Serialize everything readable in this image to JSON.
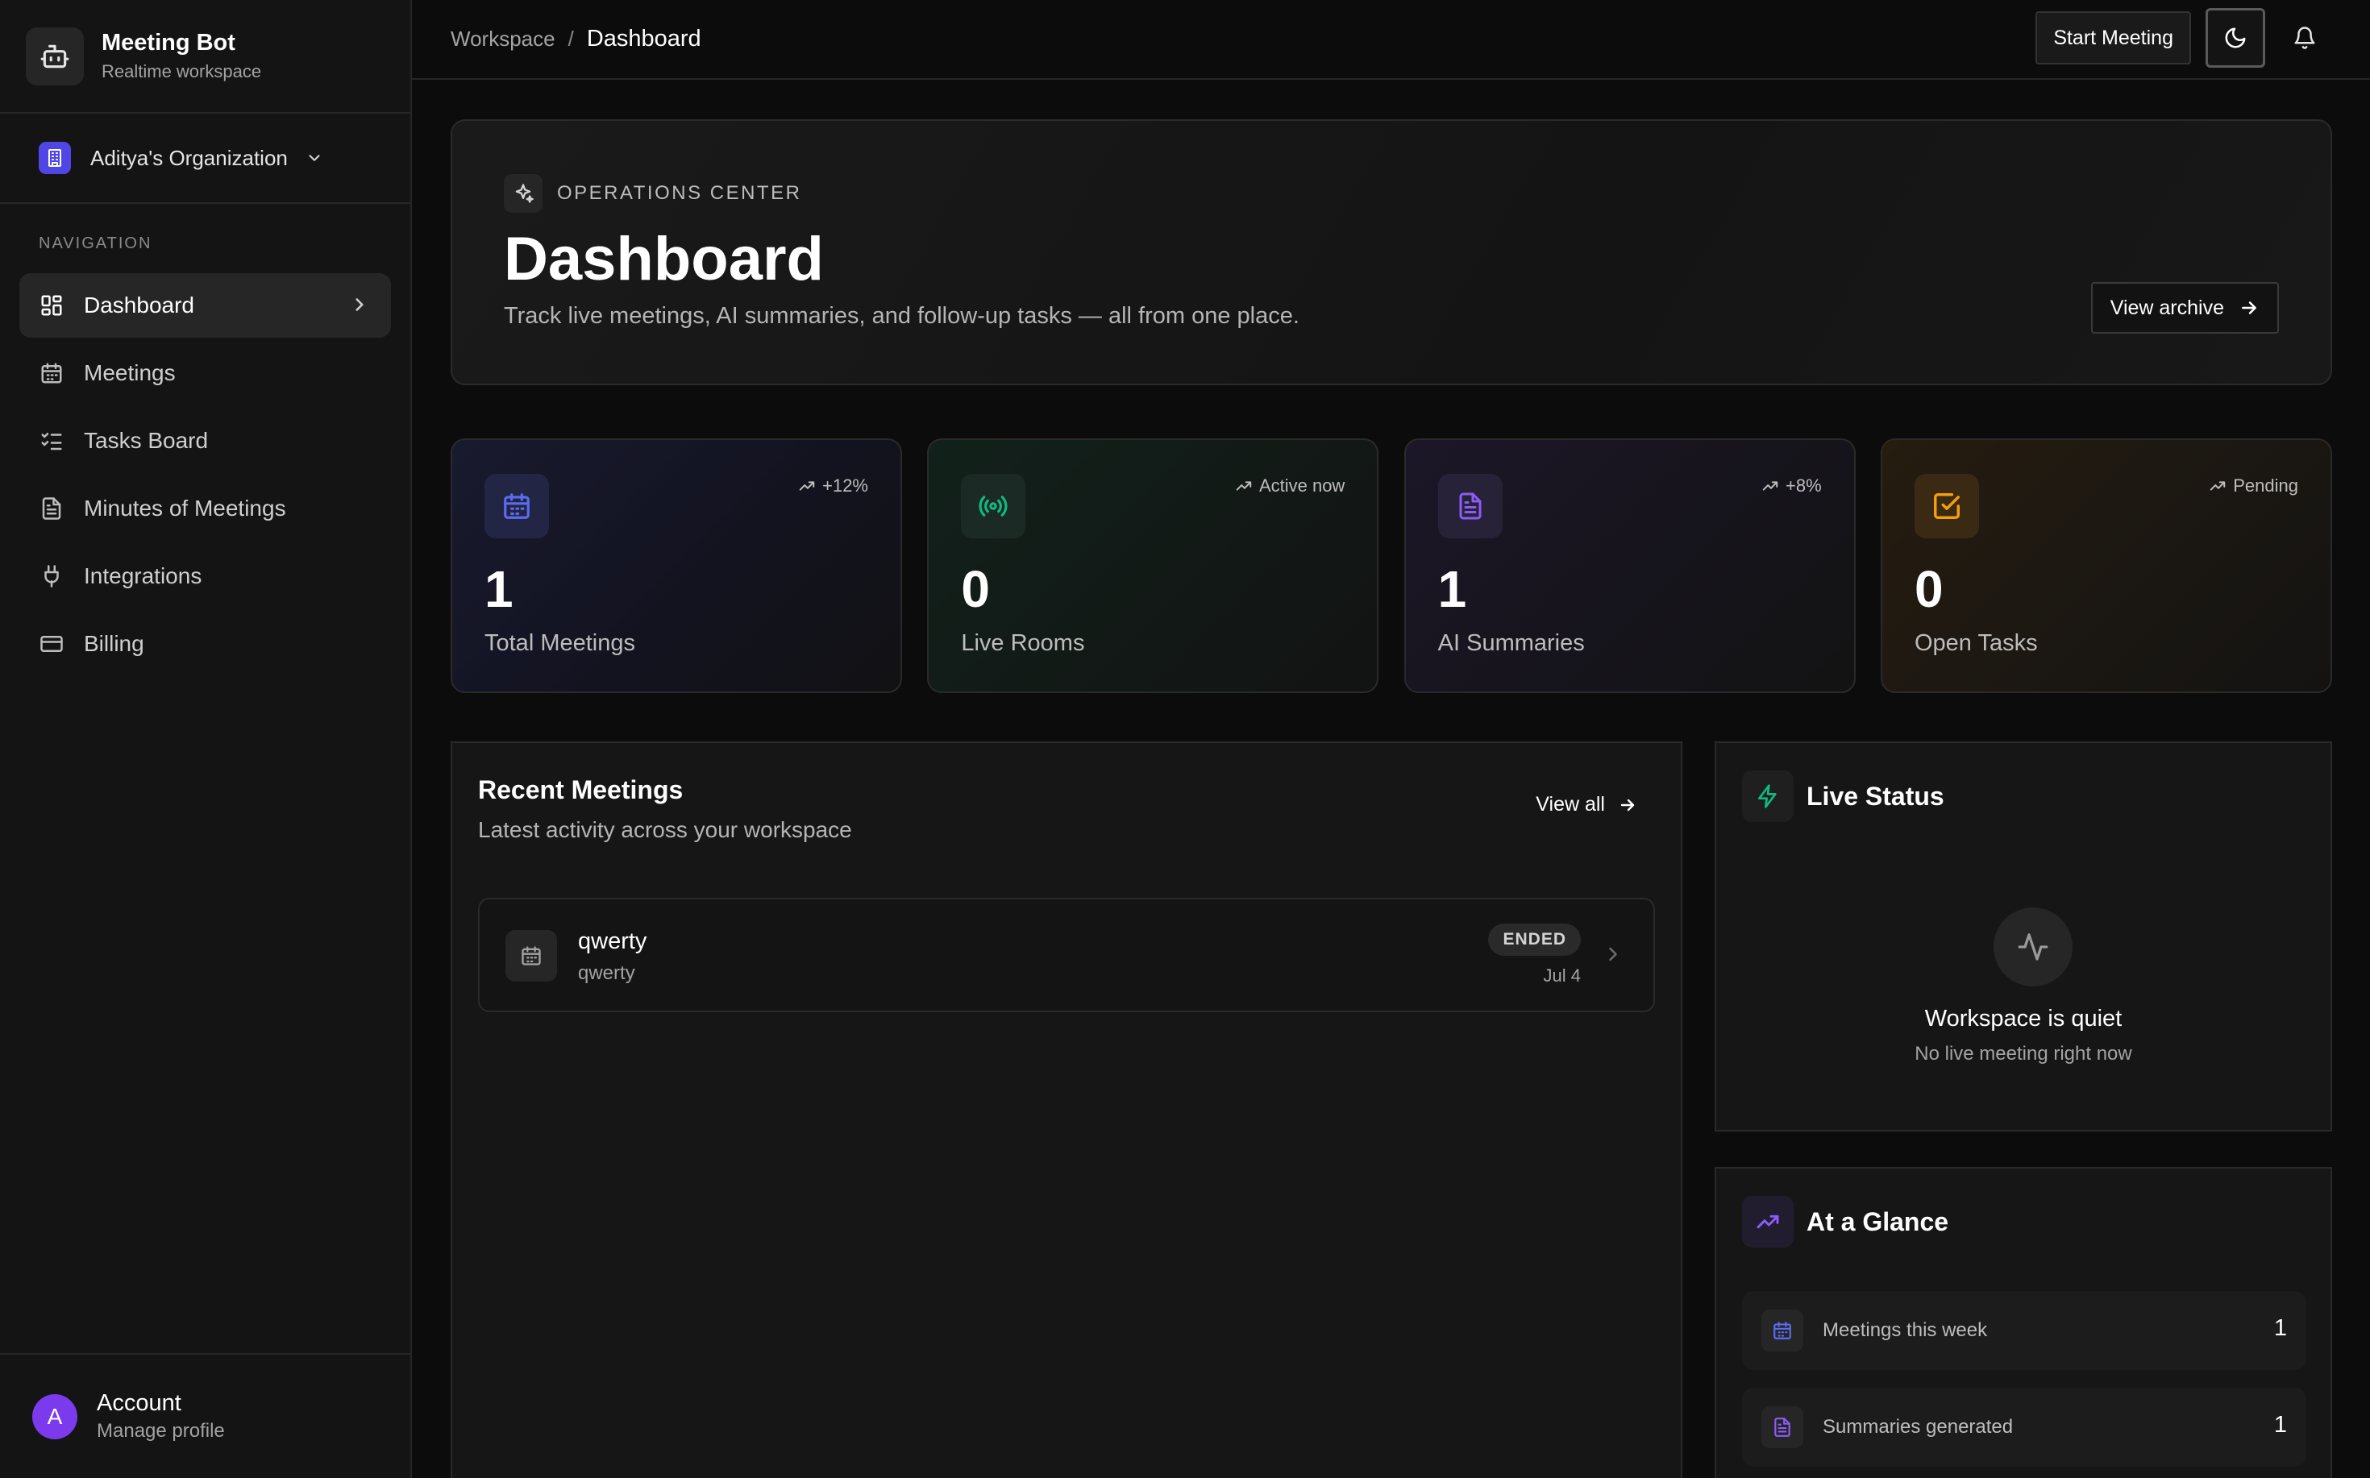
{
  "brand": {
    "title": "Meeting Bot",
    "subtitle": "Realtime workspace",
    "icon": "bot-icon"
  },
  "org": {
    "name": "Aditya's Organization",
    "icon": "building-icon",
    "accent": "#4f46e5"
  },
  "nav": {
    "heading": "NAVIGATION",
    "items": [
      {
        "label": "Dashboard",
        "icon": "layout-grid-icon",
        "active": true
      },
      {
        "label": "Meetings",
        "icon": "calendar-icon"
      },
      {
        "label": "Tasks Board",
        "icon": "list-checks-icon"
      },
      {
        "label": "Minutes of Meetings",
        "icon": "file-text-icon"
      },
      {
        "label": "Integrations",
        "icon": "plug-icon"
      },
      {
        "label": "Billing",
        "icon": "credit-card-icon"
      }
    ]
  },
  "account": {
    "initial": "A",
    "title": "Account",
    "subtitle": "Manage profile",
    "color": "#7c3aed"
  },
  "topbar": {
    "crumbs": [
      "Workspace",
      "/",
      "Dashboard"
    ],
    "start_label": "Start Meeting"
  },
  "hero": {
    "kicker": "OPERATIONS CENTER",
    "title": "Dashboard",
    "description": "Track live meetings, AI summaries, and follow-up tasks — all from one place.",
    "archive_label": "View archive"
  },
  "stats": [
    {
      "value": "1",
      "label": "Total Meetings",
      "trend": "+12%",
      "icon": "calendar-icon",
      "color": "#5b6cf0"
    },
    {
      "value": "0",
      "label": "Live Rooms",
      "trend": "Active now",
      "icon": "radio-icon",
      "color": "#10b981"
    },
    {
      "value": "1",
      "label": "AI Summaries",
      "trend": "+8%",
      "icon": "file-text-icon",
      "color": "#8b5cf6"
    },
    {
      "value": "0",
      "label": "Open Tasks",
      "trend": "Pending",
      "icon": "check-square-icon",
      "color": "#f59e0b"
    }
  ],
  "recent": {
    "title": "Recent Meetings",
    "subtitle": "Latest activity across your workspace",
    "view_all": "View all",
    "meetings": [
      {
        "title": "qwerty",
        "subtitle": "qwerty",
        "status": "ENDED",
        "date": "Jul 4"
      }
    ]
  },
  "live": {
    "title": "Live Status",
    "empty_title": "Workspace is quiet",
    "empty_sub": "No live meeting right now"
  },
  "glance": {
    "title": "At a Glance",
    "rows": [
      {
        "label": "Meetings this week",
        "value": "1",
        "icon": "calendar-icon"
      },
      {
        "label": "Summaries generated",
        "value": "1",
        "icon": "file-text-icon"
      }
    ]
  }
}
